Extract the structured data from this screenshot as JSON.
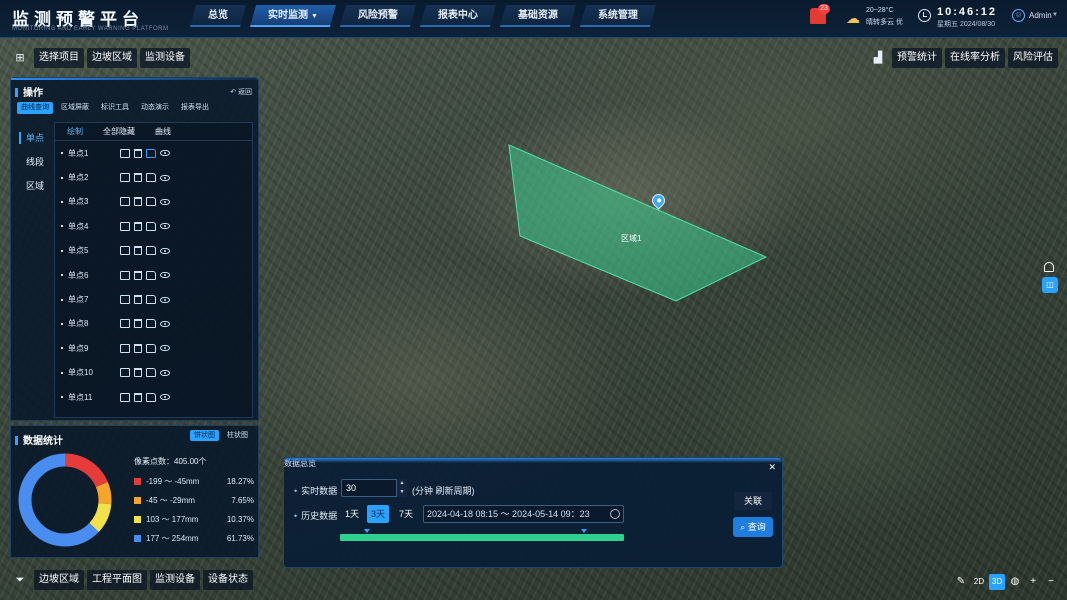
{
  "header": {
    "title": "监测预警平台",
    "subtitle": "MONITORING AND EARLY WARNING PLATFORM",
    "nav": [
      {
        "label": "总览",
        "active": false
      },
      {
        "label": "实时监测",
        "active": true,
        "caret": "▼"
      },
      {
        "label": "风险预警",
        "active": false
      },
      {
        "label": "报表中心",
        "active": false
      },
      {
        "label": "基础资源",
        "active": false
      },
      {
        "label": "系统管理",
        "active": false
      }
    ],
    "alarm_count": "23",
    "weather": {
      "temp": "20~28°C",
      "desc": "晴转多云 优",
      "icon": "cloud-sun-icon"
    },
    "time": "10:46:12",
    "date": "星期五 2024/08/30",
    "user": "Admin"
  },
  "toolbar_top": {
    "items": [
      "选择项目",
      "边坡区域",
      "监测设备"
    ]
  },
  "toolbar_right": {
    "items": [
      "预警统计",
      "在线率分析",
      "风险评估"
    ]
  },
  "toolbar_bottom": {
    "items": [
      "边坡区域",
      "工程平面图",
      "监测设备",
      "设备状态"
    ]
  },
  "ops_panel": {
    "title": "操作",
    "back": "返回",
    "subtabs": [
      "曲线查询",
      "区域屏蔽",
      "标识工具",
      "动态演示",
      "报表导出"
    ],
    "sidetabs": [
      "单点",
      "线段",
      "区域"
    ],
    "list_head": {
      "draw": "绘制",
      "hide_all": "全部隐藏",
      "curve": "曲线"
    },
    "points": [
      "单点1",
      "单点2",
      "单点3",
      "单点4",
      "单点5",
      "单点6",
      "单点7",
      "单点8",
      "单点9",
      "单点10",
      "单点11"
    ]
  },
  "stats_panel": {
    "title": "数据统计",
    "views": [
      "饼状图",
      "柱状图"
    ],
    "pixel_count": "像素点数：405.00个",
    "legend": [
      {
        "range": "-199 ～ -45mm",
        "pct": "18.27%",
        "value": 18.27,
        "color": "#e53b3b"
      },
      {
        "range": "-45 ～ -29mm",
        "pct": "7.65%",
        "value": 7.65,
        "color": "#f4a52a"
      },
      {
        "range": "103 ～ 177mm",
        "pct": "10.37%",
        "value": 10.37,
        "color": "#f2e14a"
      },
      {
        "range": "177 ～ 254mm",
        "pct": "61.73%",
        "value": 61.73,
        "color": "#4a8df0"
      }
    ]
  },
  "map": {
    "region_label": "区域1"
  },
  "query_panel": {
    "realtime_label": "实时数据",
    "realtime_value": "30",
    "realtime_unit": "(分钟 刷新周期)",
    "history_label": "历史数据",
    "days": [
      "1天",
      "3天",
      "7天"
    ],
    "active_day": "3天",
    "range": "2024-04-18 08:15 ～ 2024-05-14 09：23",
    "overview_label": "数据总览",
    "relate": "关联",
    "search": "查询"
  },
  "bottom_right": {
    "view_2d": "2D",
    "view_3d": "3D"
  }
}
